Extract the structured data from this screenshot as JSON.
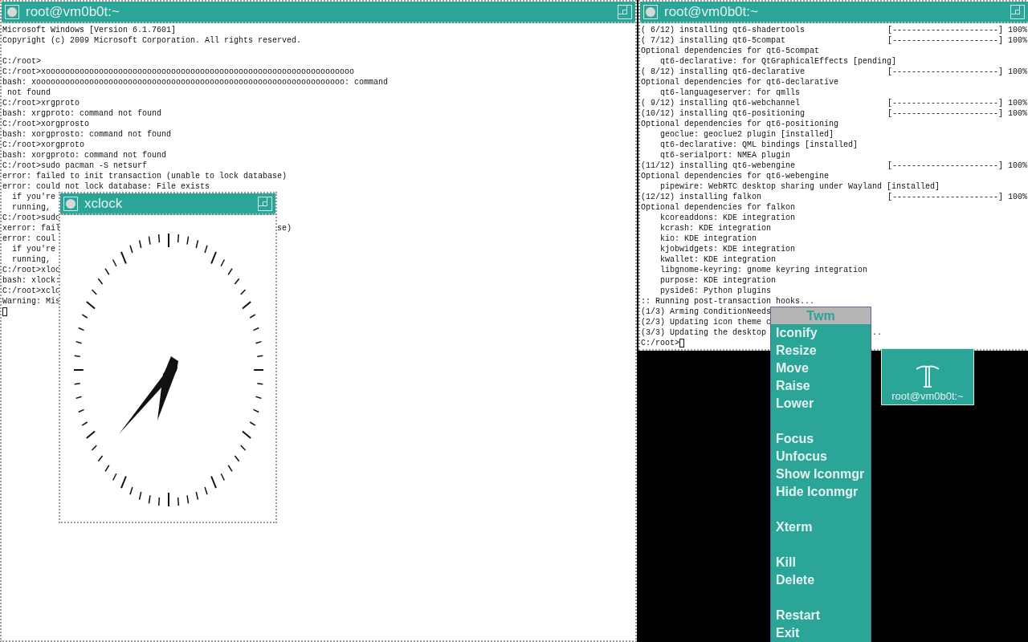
{
  "windows": [
    {
      "kind": "terminal",
      "title": "root@vm0b0t:~",
      "lines": [
        {
          "text": "Microsoft Windows [Version 6.1.7601]"
        },
        {
          "text": "Copyright (c) 2009 Microsoft Corporation. All rights reserved."
        },
        {
          "blank": true
        },
        {
          "text": "C:/root>"
        },
        {
          "text": "C:/root>xoooooooooooooooooooooooooooooooooooooooooooooooooooooooooooooooo"
        },
        {
          "text": "bash: xoooooooooooooooooooooooooooooooooooooooooooooooooooooooooooooooo: command"
        },
        {
          "text": " not found"
        },
        {
          "text": "C:/root>xrgproto"
        },
        {
          "text": "bash: xrgproto: command not found"
        },
        {
          "text": "C:/root>xorgprosto"
        },
        {
          "text": "bash: xorgprosto: command not found"
        },
        {
          "text": "C:/root>xorgproto"
        },
        {
          "text": "bash: xorgproto: command not found"
        },
        {
          "text": "C:/root>sudo pacman -S netsurf"
        },
        {
          "text": "error: failed to init transaction (unable to lock database)"
        },
        {
          "text": "error: could not lock database: File exists"
        },
        {
          "text": "  if you're"
        },
        {
          "text": "  running,"
        },
        {
          "text": "C:/root>sudo"
        },
        {
          "text": "xerror: fail",
          "tail": "se)"
        },
        {
          "text": "error: coul"
        },
        {
          "text": "  if you're"
        },
        {
          "text": "  running,"
        },
        {
          "text": "C:/root>xloc"
        },
        {
          "text": "bash: xlock:"
        },
        {
          "text": "C:/root>xclo"
        },
        {
          "text": "Warning: Mis"
        },
        {
          "cursor": true
        }
      ]
    },
    {
      "kind": "terminal",
      "title": "root@vm0b0t:~",
      "lines": [
        {
          "text": "( 6/12) installing qt6-shadertools",
          "bar": "[----------------------]",
          "percent": "100%"
        },
        {
          "text": "( 7/12) installing qt6-5compat",
          "bar": "[----------------------]",
          "percent": "100%"
        },
        {
          "text": "Optional dependencies for qt6-5compat"
        },
        {
          "text": "    qt6-declarative: for QtGraphicalEffects [pending]"
        },
        {
          "text": "( 8/12) installing qt6-declarative",
          "bar": "[----------------------]",
          "percent": "100%"
        },
        {
          "text": "Optional dependencies for qt6-declarative"
        },
        {
          "text": "    qt6-languageserver: for qmlls"
        },
        {
          "text": "( 9/12) installing qt6-webchannel",
          "bar": "[----------------------]",
          "percent": "100%"
        },
        {
          "text": "(10/12) installing qt6-positioning",
          "bar": "[----------------------]",
          "percent": "100%"
        },
        {
          "text": "Optional dependencies for qt6-positioning"
        },
        {
          "text": "    geoclue: geoclue2 plugin [installed]"
        },
        {
          "text": "    qt6-declarative: QML bindings [installed]"
        },
        {
          "text": "    qt6-serialport: NMEA plugin"
        },
        {
          "text": "(11/12) installing qt6-webengine",
          "bar": "[----------------------]",
          "percent": "100%"
        },
        {
          "text": "Optional dependencies for qt6-webengine"
        },
        {
          "text": "    pipewire: WebRTC desktop sharing under Wayland [installed]"
        },
        {
          "text": "(12/12) installing falkon",
          "bar": "[----------------------]",
          "percent": "100%"
        },
        {
          "text": "Optional dependencies for falkon"
        },
        {
          "text": "    kcoreaddons: KDE integration"
        },
        {
          "text": "    kcrash: KDE integration"
        },
        {
          "text": "    kio: KDE integration"
        },
        {
          "text": "    kjobwidgets: KDE integration"
        },
        {
          "text": "    kwallet: KDE integration"
        },
        {
          "text": "    libgnome-keyring: gnome keyring integration"
        },
        {
          "text": "    purpose: KDE integration"
        },
        {
          "text": "    pyside6: Python plugins"
        },
        {
          "text": ":: Running post-transaction hooks..."
        },
        {
          "text": "(1/3) Arming ConditionNeeds"
        },
        {
          "text": "(2/3) Updating icon theme c"
        },
        {
          "text": "(3/3) Updating the desktop",
          "tail": ".."
        },
        {
          "text": "C:/root>",
          "cursor": true
        }
      ]
    },
    {
      "kind": "clock",
      "title": "xclock"
    }
  ],
  "menu": {
    "title": "Twm",
    "items": [
      {
        "kind": "item",
        "label": "Iconify"
      },
      {
        "kind": "item",
        "label": "Resize"
      },
      {
        "kind": "item",
        "label": "Move"
      },
      {
        "kind": "item",
        "label": "Raise"
      },
      {
        "kind": "item",
        "label": "Lower"
      },
      {
        "kind": "separator"
      },
      {
        "kind": "item",
        "label": "Focus"
      },
      {
        "kind": "item",
        "label": "Unfocus"
      },
      {
        "kind": "item",
        "label": "Show Iconmgr"
      },
      {
        "kind": "item",
        "label": "Hide Iconmgr"
      },
      {
        "kind": "separator"
      },
      {
        "kind": "item",
        "label": "Xterm"
      },
      {
        "kind": "separator"
      },
      {
        "kind": "item",
        "label": "Kill"
      },
      {
        "kind": "item",
        "label": "Delete"
      },
      {
        "kind": "separator"
      },
      {
        "kind": "item",
        "label": "Restart"
      },
      {
        "kind": "item",
        "label": "Exit"
      }
    ]
  },
  "icon": {
    "label": "root@vm0b0t:~"
  }
}
